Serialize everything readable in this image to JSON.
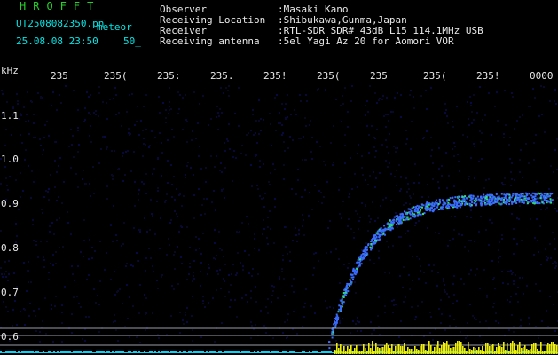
{
  "header": {
    "title": "HROFFT",
    "file_name": "UT2508082350.pn",
    "mode_label": "meteor",
    "date_time": "25.08.08 23:50",
    "count": "50_"
  },
  "station_info": [
    {
      "key": "Observer",
      "value": ":Masaki Kano"
    },
    {
      "key": "Receiving Location",
      "value": ":Shibukawa,Gunma,Japan"
    },
    {
      "key": "Receiver",
      "value": ":RTL-SDR SDR# 43dB L15 114.1MHz USB"
    },
    {
      "key": "Receiving antenna",
      "value": ":5el Yagi Az 20 for Aomori VOR"
    }
  ],
  "plot": {
    "y_unit": "kHz",
    "y_ticks": [
      "1.1",
      "1.0",
      "0.9",
      "0.8",
      "0.7",
      "0.6"
    ],
    "x_ticks": [
      "235",
      "235(",
      "235:",
      "235.",
      "235!",
      "235(",
      "235",
      "235(",
      "235!",
      "0000"
    ],
    "colors": {
      "background": "#000000",
      "noise": "#0a0a3a",
      "signal": "#3a6cff",
      "signal_hot": "#30e070",
      "baseline": "#00d8ff",
      "burst": "#f0f000",
      "grid_line": "#9a9aa8"
    }
  }
}
